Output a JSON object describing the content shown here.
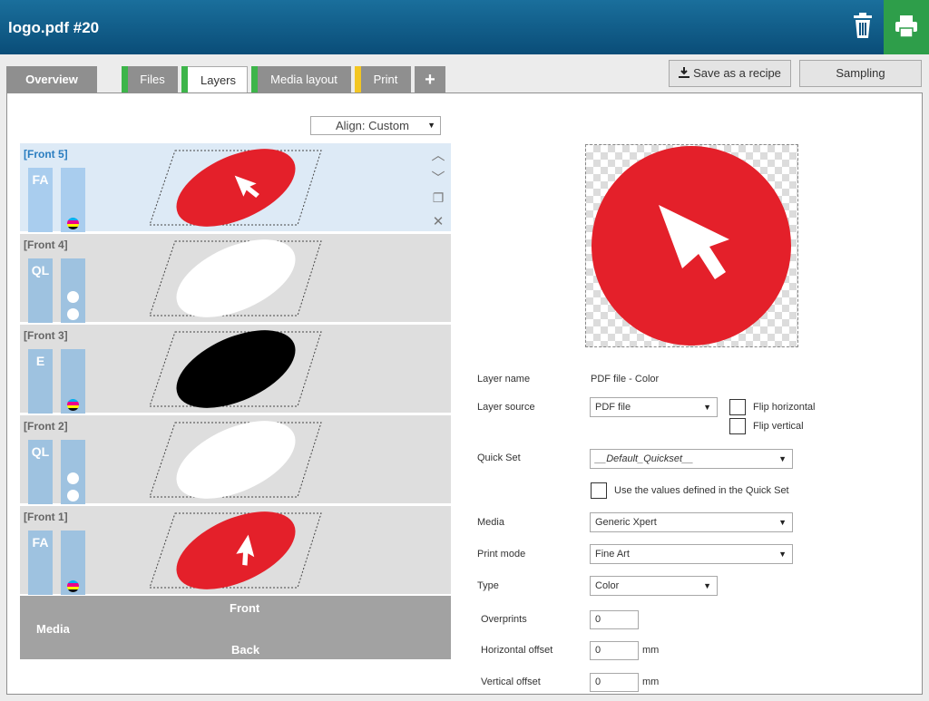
{
  "header": {
    "title": "logo.pdf #20",
    "trash_icon": "trash-icon",
    "print_icon": "printer-icon"
  },
  "tabs": [
    {
      "label": "Overview",
      "stripe": ""
    },
    {
      "label": "Files",
      "stripe": "#3db54a"
    },
    {
      "label": "Layers",
      "stripe": "#3db54a"
    },
    {
      "label": "Media layout",
      "stripe": "#3db54a"
    },
    {
      "label": "Print",
      "stripe": "#f3c623"
    },
    {
      "label": "+"
    }
  ],
  "toolbar": {
    "save_recipe": "Save as a recipe",
    "sampling": "Sampling"
  },
  "align": {
    "label": "Align: Custom"
  },
  "layers": [
    {
      "name": "[Front 5]",
      "code": "FA",
      "ink": "cmyk",
      "fill": "#e4202a",
      "arrow": true
    },
    {
      "name": "[Front 4]",
      "code": "QL",
      "ink": "white",
      "fill": "#ffffff",
      "arrow": false
    },
    {
      "name": "[Front 3]",
      "code": "E",
      "ink": "cmyk",
      "fill": "#000000",
      "arrow": false
    },
    {
      "name": "[Front 2]",
      "code": "QL",
      "ink": "white",
      "fill": "#ffffff",
      "arrow": false
    },
    {
      "name": "[Front 1]",
      "code": "FA",
      "ink": "cmyk",
      "fill": "#e4202a",
      "arrow": true
    }
  ],
  "media": {
    "label": "Media",
    "front": "Front",
    "back": "Back"
  },
  "form": {
    "layer_name_label": "Layer name",
    "layer_name_value": "PDF file - Color",
    "layer_source_label": "Layer source",
    "layer_source_value": "PDF file",
    "flip_horizontal": "Flip horizontal",
    "flip_vertical": "Flip vertical",
    "quick_set_label": "Quick Set",
    "quick_set_value": "__Default_Quickset__",
    "use_quickset": "Use the values defined in the Quick Set",
    "media_label": "Media",
    "media_value": "Generic Xpert",
    "print_mode_label": "Print mode",
    "print_mode_value": "Fine Art",
    "type_label": "Type",
    "type_value": "Color",
    "overprints_label": "Overprints",
    "overprints_value": "0",
    "h_offset_label": "Horizontal offset",
    "h_offset_value": "0",
    "h_offset_unit": "mm",
    "v_offset_label": "Vertical offset",
    "v_offset_value": "0",
    "v_offset_unit": "mm"
  },
  "colors": {
    "header": "#0a4d78",
    "print_green": "#2e9e4a",
    "accent_red": "#e4202a",
    "selected_row": "#ddeaf6"
  }
}
